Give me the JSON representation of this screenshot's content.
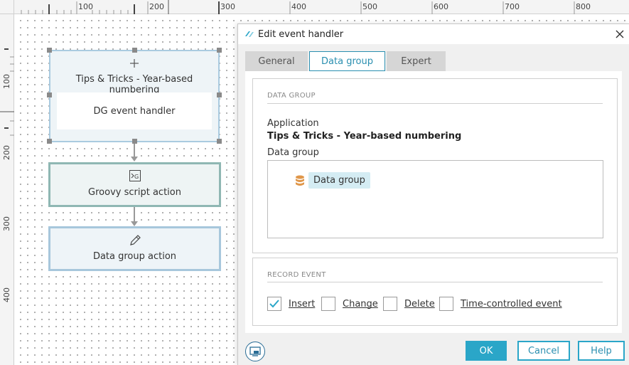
{
  "ruler": {
    "top_labels": [
      "100",
      "200",
      "300",
      "400",
      "500",
      "600",
      "700",
      "800"
    ],
    "left_labels": [
      "100",
      "200",
      "300",
      "400"
    ]
  },
  "flow": {
    "handler_node": {
      "title": "Tips & Tricks - Year-based numbering",
      "inner_label": "DG event handler",
      "icon": "plus-icon"
    },
    "groovy_node": {
      "label": "Groovy script action",
      "icon": "groovy-script-icon"
    },
    "datagroup_node": {
      "label": "Data group action",
      "icon": "pencil-icon"
    }
  },
  "dialog": {
    "title": "Edit event handler",
    "tabs": [
      {
        "label": "General",
        "active": false
      },
      {
        "label": "Data group",
        "active": true
      },
      {
        "label": "Expert",
        "active": false
      }
    ],
    "data_group_section": {
      "caption": "DATA GROUP",
      "application_label": "Application",
      "application_value": "Tips & Tricks - Year-based numbering",
      "data_group_label": "Data group",
      "selected_item": "Data group"
    },
    "record_event_section": {
      "caption": "RECORD EVENT",
      "options": [
        {
          "label": "Insert",
          "checked": true
        },
        {
          "label": "Change",
          "checked": false
        },
        {
          "label": "Delete",
          "checked": false
        },
        {
          "label": "Time-controlled event",
          "checked": false
        }
      ]
    },
    "buttons": {
      "ok": "OK",
      "cancel": "Cancel",
      "help": "Help"
    }
  },
  "colors": {
    "accent": "#2aa6c8",
    "chip_bg": "#d4ecf3",
    "database_icon": "#e0974a"
  }
}
